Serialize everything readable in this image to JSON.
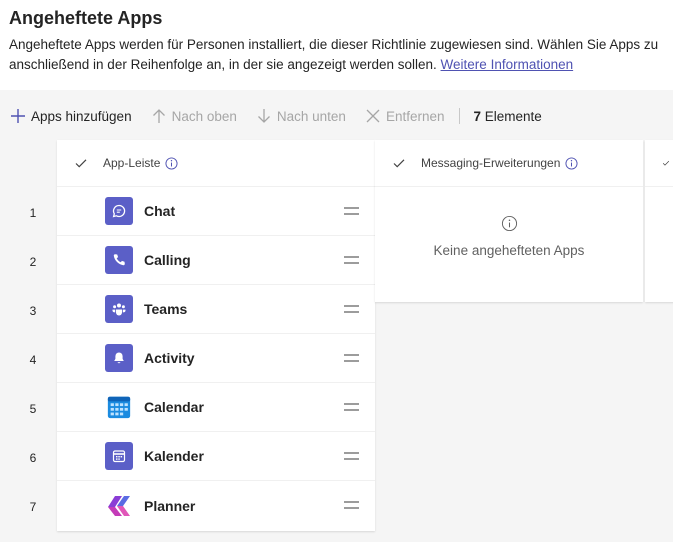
{
  "page": {
    "title": "Angeheftete Apps",
    "description_line1": "Angeheftete Apps werden für Personen installiert, die dieser Richtlinie zugewiesen sind. Wählen Sie Apps zu",
    "description_line2": "anschließend in der Reihenfolge an, in der sie angezeigt werden sollen.",
    "learn_more": "Weitere Informationen"
  },
  "toolbar": {
    "add": "Apps hinzufügen",
    "move_up": "Nach oben",
    "move_down": "Nach unten",
    "remove": "Entfernen",
    "count_number": "7",
    "count_label": "Elemente"
  },
  "app_bar": {
    "header": "App-Leiste",
    "numbers": [
      "1",
      "2",
      "3",
      "4",
      "5",
      "6",
      "7"
    ],
    "apps": [
      {
        "name": "Chat",
        "icon": "chat-icon"
      },
      {
        "name": "Calling",
        "icon": "phone-icon"
      },
      {
        "name": "Teams",
        "icon": "teams-icon"
      },
      {
        "name": "Activity",
        "icon": "bell-icon"
      },
      {
        "name": "Calendar",
        "icon": "calendar-grid-icon"
      },
      {
        "name": "Kalender",
        "icon": "calendar-icon"
      },
      {
        "name": "Planner",
        "icon": "planner-icon"
      }
    ]
  },
  "messaging": {
    "header": "Messaging-Erweiterungen",
    "empty": "Keine angehefteten Apps"
  },
  "colors": {
    "accent": "#6264a7",
    "link": "#4f52b2"
  }
}
